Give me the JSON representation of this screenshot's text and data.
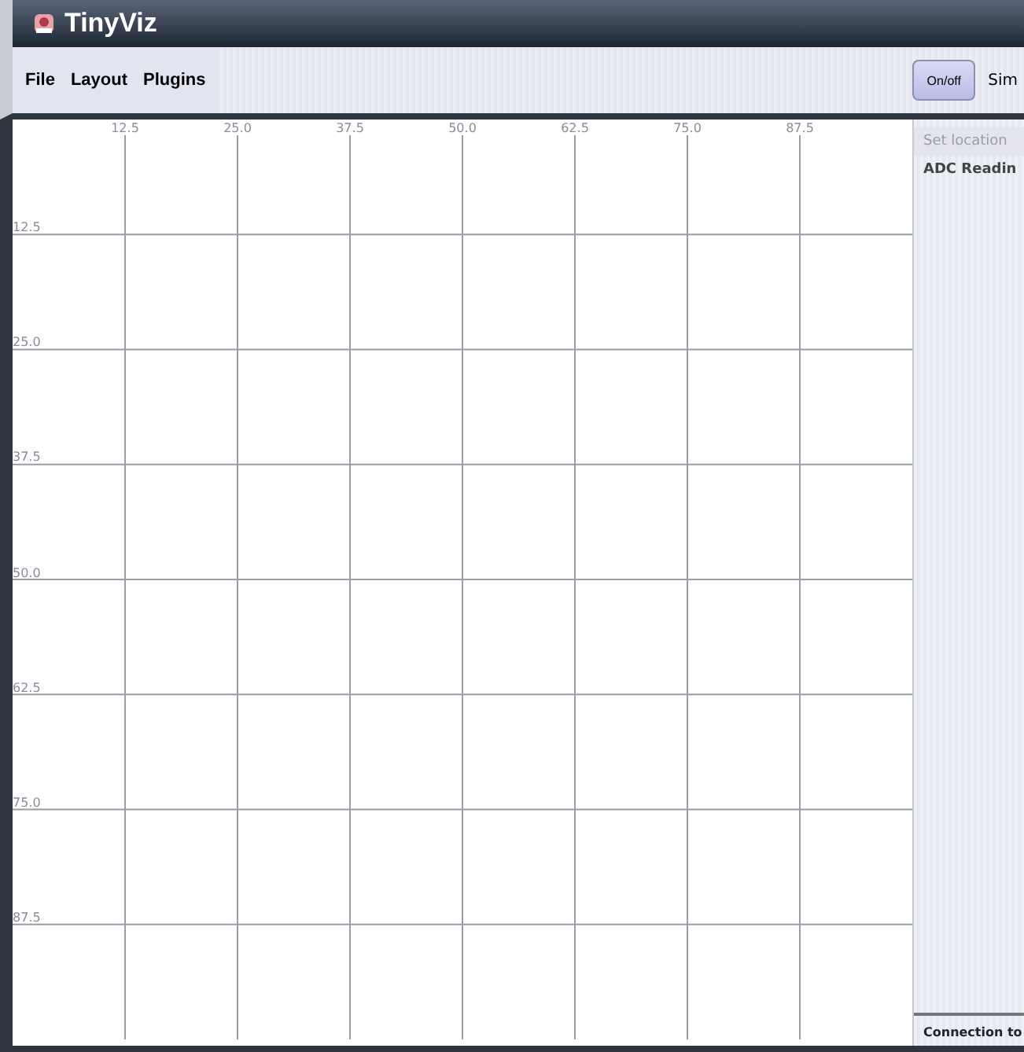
{
  "window": {
    "title": "TinyViz"
  },
  "menu": [
    "File",
    "Layout",
    "Plugins"
  ],
  "toolbar": {
    "button": "On/off",
    "label": "Sim"
  },
  "canvas": {
    "x_labels": [
      "12.5",
      "25.0",
      "37.5",
      "50.0",
      "62.5",
      "75.0",
      "87.5"
    ],
    "y_labels": [
      "12.5",
      "25.0",
      "37.5",
      "50.0",
      "62.5",
      "75.0",
      "87.5"
    ]
  },
  "plugins": [
    {
      "label": "Set location",
      "disabled": true
    },
    {
      "label": "ADC Readin",
      "disabled": false
    }
  ],
  "status": "Connection to"
}
